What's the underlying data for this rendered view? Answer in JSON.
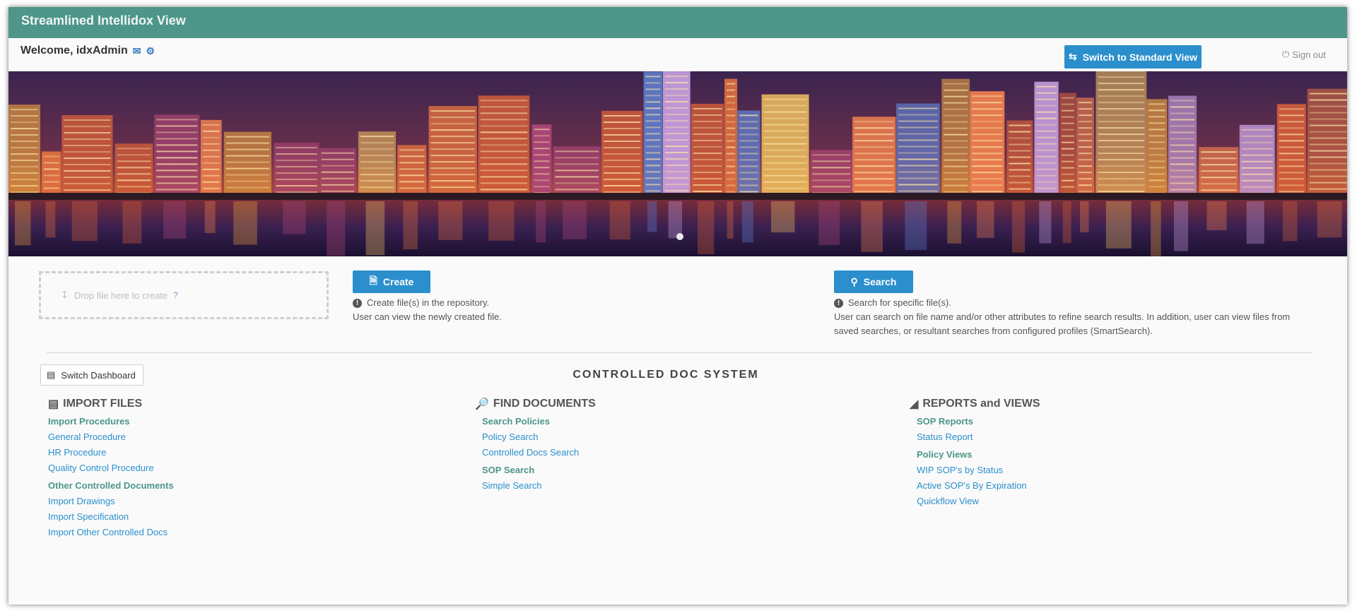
{
  "app": {
    "title": "Streamlined Intellidox View"
  },
  "header": {
    "welcome": "Welcome, idxAdmin",
    "switch_view": "Switch to Standard View",
    "sign_out": "Sign out"
  },
  "icons": [
    "mail-icon",
    "gear-icon",
    "swap-icon",
    "power-icon",
    "upload-icon",
    "help-icon",
    "create-doc-icon",
    "search-icon",
    "info-icon",
    "dashboard-icon",
    "file-list-icon",
    "find-doc-icon",
    "chart-icon"
  ],
  "drop": {
    "label": "Drop file here to create",
    "help": "?"
  },
  "create": {
    "label": "Create",
    "desc1": "Create file(s) in the repository.",
    "desc2": "User can view the newly created file."
  },
  "search": {
    "label": "Search",
    "desc1": "Search for specific file(s).",
    "desc2": "User can search on file name and/or other attributes to refine search results. In addition, user can view files from saved searches, or resultant searches from configured profiles (SmartSearch)."
  },
  "dashboard": {
    "switch": "Switch Dashboard",
    "title": "CONTROLLED DOC SYSTEM"
  },
  "columns": [
    {
      "title": "IMPORT FILES",
      "groups": [
        {
          "heading": "Import Procedures",
          "links": [
            "General Procedure",
            "HR Procedure",
            "Quality Control Procedure"
          ]
        },
        {
          "heading": "Other Controlled Documents",
          "links": [
            "Import Drawings",
            "Import Specification",
            "Import Other Controlled Docs"
          ]
        }
      ]
    },
    {
      "title": "FIND DOCUMENTS",
      "groups": [
        {
          "heading": "Search Policies",
          "links": [
            "Policy Search",
            "Controlled Docs Search"
          ]
        },
        {
          "heading": "SOP Search",
          "links": [
            "Simple Search"
          ]
        }
      ]
    },
    {
      "title": "REPORTS and VIEWS",
      "groups": [
        {
          "heading": "SOP Reports",
          "links": [
            "Status Report"
          ]
        },
        {
          "heading": "Policy Views",
          "links": [
            "WIP SOP's by Status",
            "Active SOP's By Expiration",
            "Quickflow View"
          ]
        }
      ]
    }
  ]
}
